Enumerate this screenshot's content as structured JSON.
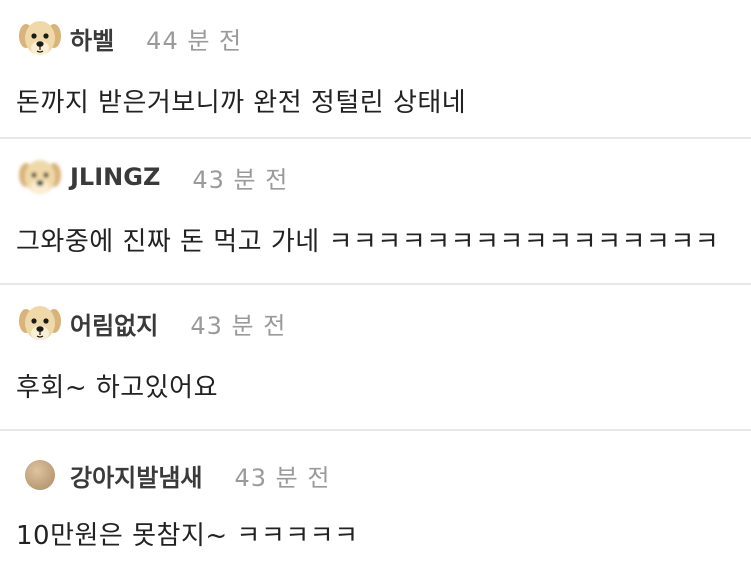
{
  "comments": [
    {
      "author": "하벨",
      "time": "44 분 전",
      "text": "돈까지 받은거보니까 완전 정털린 상태네",
      "avatar": "puppy-avatar-icon"
    },
    {
      "author": "JLINGZ",
      "time": "43 분 전",
      "text": "그와중에 진짜 돈 먹고 가네 ㅋㅋㅋㅋㅋㅋㅋㅋㅋㅋㅋㅋㅋㅋㅋㅋ",
      "avatar": "blurred-puppy-avatar-icon"
    },
    {
      "author": "어림없지",
      "time": "43 분 전",
      "text": "후회~ 하고있어요",
      "avatar": "puppy-avatar-icon"
    },
    {
      "author": "강아지발냄새",
      "time": "43 분 전",
      "text": "10만원은 못참지~ ㅋㅋㅋㅋㅋ",
      "avatar": "beige-circle-avatar-icon"
    }
  ],
  "colors": {
    "author": "#3a3a3a",
    "time": "#9a9a9a",
    "text": "#222222",
    "divider": "#e8e8e8",
    "puppy_fur": "#f0d9a8",
    "puppy_ears": "#d9b47a",
    "beige_avatar": "#c9ad87"
  }
}
